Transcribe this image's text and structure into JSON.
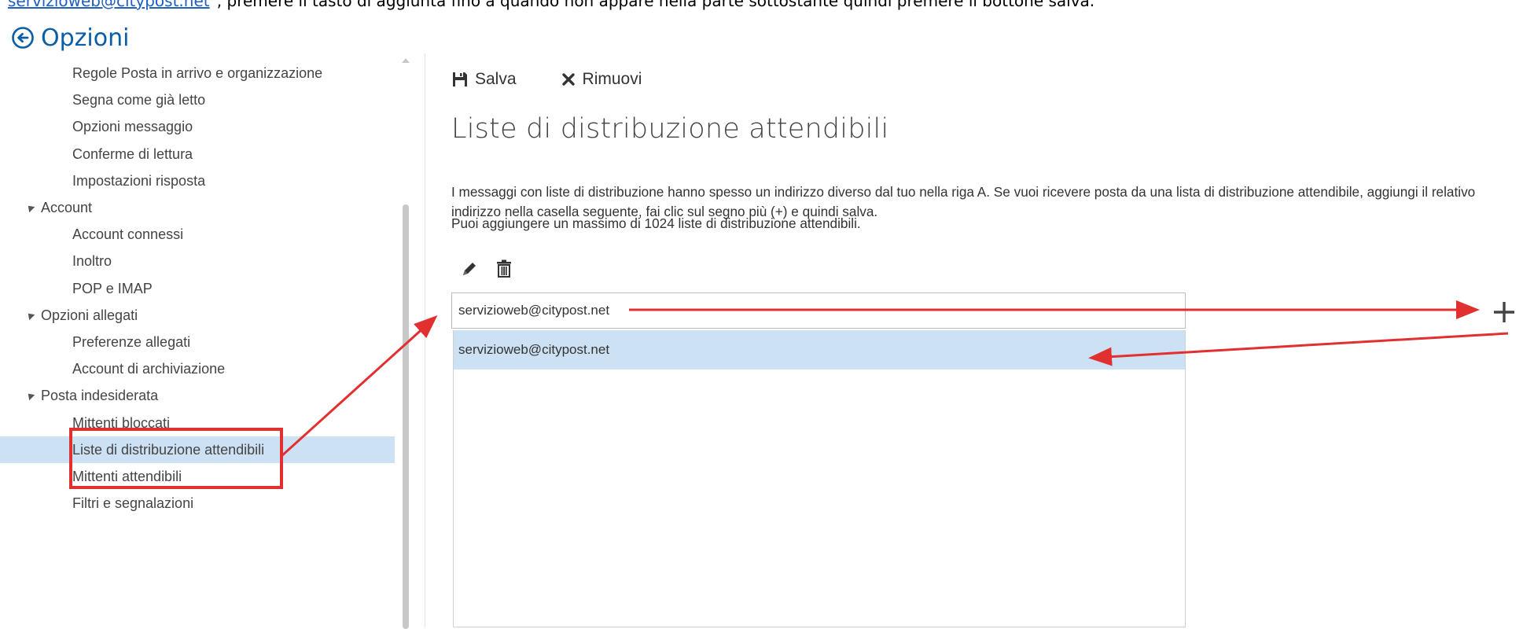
{
  "caption": {
    "link_text": "servizioweb@citypost.net",
    "rest_text": "\", premere il tasto di aggiunta fino a quando non appare nella parte sottostante quindi premere il bottone salva."
  },
  "header": {
    "title": "Opzioni",
    "back_icon": "back-circle-arrow-icon"
  },
  "nav": {
    "items": [
      {
        "label": "Regole Posta in arrivo e organizzazione",
        "level": 2
      },
      {
        "label": "Segna come già letto",
        "level": 2
      },
      {
        "label": "Opzioni messaggio",
        "level": 2
      },
      {
        "label": "Conferme di lettura",
        "level": 2
      },
      {
        "label": "Impostazioni risposta",
        "level": 2
      },
      {
        "label": "Account",
        "level": 1
      },
      {
        "label": "Account connessi",
        "level": 2
      },
      {
        "label": "Inoltro",
        "level": 2
      },
      {
        "label": "POP e IMAP",
        "level": 2
      },
      {
        "label": "Opzioni allegati",
        "level": 1
      },
      {
        "label": "Preferenze allegati",
        "level": 2
      },
      {
        "label": "Account di archiviazione",
        "level": 2
      },
      {
        "label": "Posta indesiderata",
        "level": 1
      },
      {
        "label": "Mittenti bloccati",
        "level": 2
      },
      {
        "label": "Liste di distribuzione attendibili",
        "level": 2,
        "selected": true
      },
      {
        "label": "Mittenti attendibili",
        "level": 2
      },
      {
        "label": "Filtri e segnalazioni",
        "level": 2
      }
    ]
  },
  "toolbar": {
    "save_label": "Salva",
    "remove_label": "Rimuovi"
  },
  "main": {
    "heading": "Liste di distribuzione attendibili",
    "description": "I messaggi con liste di distribuzione hanno spesso un indirizzo diverso dal tuo nella riga A. Se vuoi ricevere posta da una lista di distribuzione attendibile, aggiungi il relativo indirizzo nella casella seguente, fai clic sul segno più (+) e quindi salva.",
    "limit_text": "Puoi aggiungere un massimo di 1024 liste di distribuzione attendibili.",
    "input_value": "servizioweb@citypost.net",
    "list_items": [
      "servizioweb@citypost.net"
    ]
  },
  "colors": {
    "accent": "#0a5ea8",
    "selection": "#cce1f4",
    "annotation": "#e23030"
  }
}
